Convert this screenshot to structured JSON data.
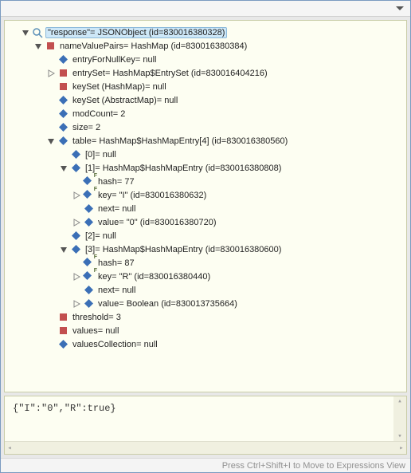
{
  "tree": {
    "root": {
      "label": "\"response\"= JSONObject  (id=830016380328)",
      "children": {
        "nvp": {
          "label": "nameValuePairs= HashMap  (id=830016380384)",
          "entryForNullKey": "entryForNullKey= null",
          "entrySet": "entrySet= HashMap$EntrySet  (id=830016404216)",
          "keySetHashMap": "keySet (HashMap)= null",
          "keySetAbstract": "keySet (AbstractMap)= null",
          "modCount": "modCount= 2",
          "size": "size= 2",
          "table": {
            "label": "table= HashMap$HashMapEntry[4]  (id=830016380560)",
            "i0": "[0]= null",
            "i1": {
              "label": "[1]= HashMap$HashMapEntry  (id=830016380808)",
              "hash": "hash= 77",
              "key": "key= \"I\" (id=830016380632)",
              "next": "next= null",
              "value": "value= \"0\" (id=830016380720)"
            },
            "i2": "[2]= null",
            "i3": {
              "label": "[3]= HashMap$HashMapEntry  (id=830016380600)",
              "hash": "hash= 87",
              "key": "key= \"R\" (id=830016380440)",
              "next": "next= null",
              "value": "value= Boolean  (id=830013735664)"
            }
          },
          "threshold": "threshold= 3",
          "values": "values= null",
          "valuesCollection": "valuesCollection= null"
        }
      }
    }
  },
  "chart_data": {
    "type": "table",
    "title": "response JSONObject inspection",
    "object_id": 830016380328,
    "nameValuePairs": {
      "type": "HashMap",
      "id": 830016380384,
      "modCount": 2,
      "size": 2,
      "threshold": 3,
      "entryForNullKey": null,
      "entrySet_id": 830016404216,
      "table_length": 4,
      "table_id": 830016380560,
      "entries": [
        {
          "index": 1,
          "hash": 77,
          "key": "I",
          "key_id": 830016380632,
          "value": "0",
          "value_id": 830016380720,
          "next": null
        },
        {
          "index": 3,
          "hash": 87,
          "key": "R",
          "key_id": 830016380440,
          "value": true,
          "value_id": 830013735664,
          "next": null
        }
      ]
    }
  },
  "detail": "{\"I\":\"0\",\"R\":true}",
  "status": "Press Ctrl+Shift+I to Move to Expressions View"
}
